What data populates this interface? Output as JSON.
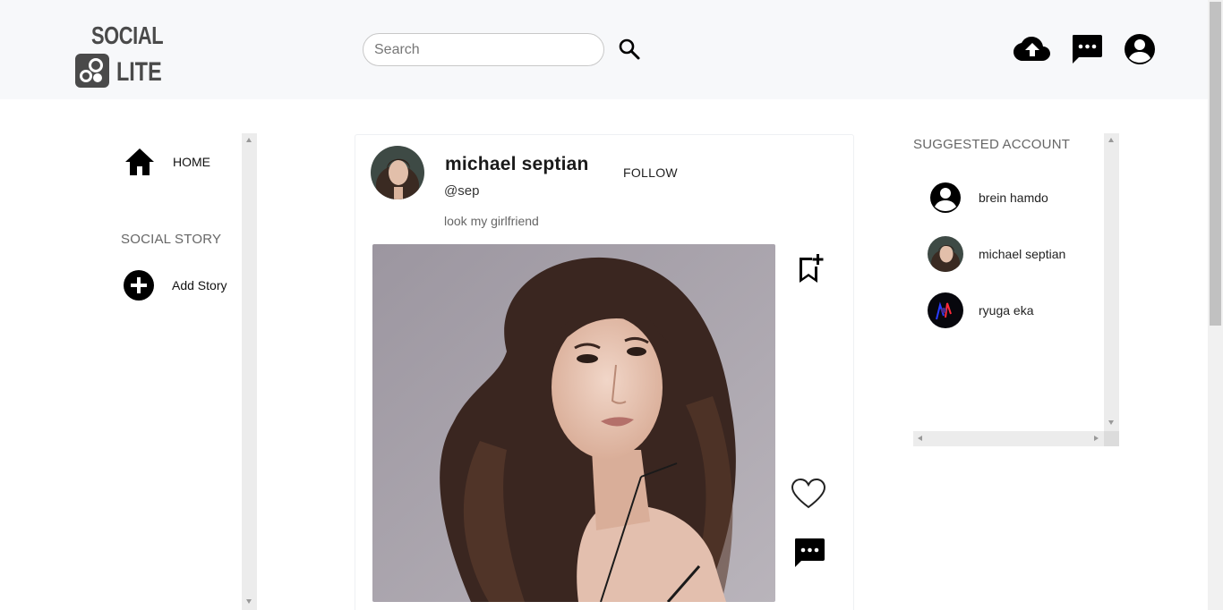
{
  "header": {
    "logo_line1": "SOCIAL",
    "logo_line2": "LITE",
    "search_placeholder": "Search",
    "icons": [
      "search-icon",
      "upload-cloud-icon",
      "chat-icon",
      "account-circle-icon"
    ]
  },
  "sidebar": {
    "home_label": "HOME",
    "section_title": "SOCIAL STORY",
    "add_story_label": "Add Story",
    "icons": [
      "home-icon",
      "add-circle-icon"
    ]
  },
  "post": {
    "author_name": "michael septian",
    "author_handle": "@sep",
    "follow_label": "FOLLOW",
    "caption": "look my girlfriend",
    "icons": [
      "bookmark-add-icon",
      "heart-icon",
      "comment-icon"
    ]
  },
  "suggested": {
    "title": "SUGGESTED ACCOUNT",
    "accounts": [
      {
        "name": "brein hamdo",
        "avatar": "default-avatar-icon"
      },
      {
        "name": "michael septian",
        "avatar": "photo"
      },
      {
        "name": "ryuga eka",
        "avatar": "photo"
      }
    ]
  },
  "colors": {
    "header_bg": "#f7f8fa",
    "icon": "#000000",
    "muted_text": "#666666",
    "logo": "#4a4a4a"
  }
}
